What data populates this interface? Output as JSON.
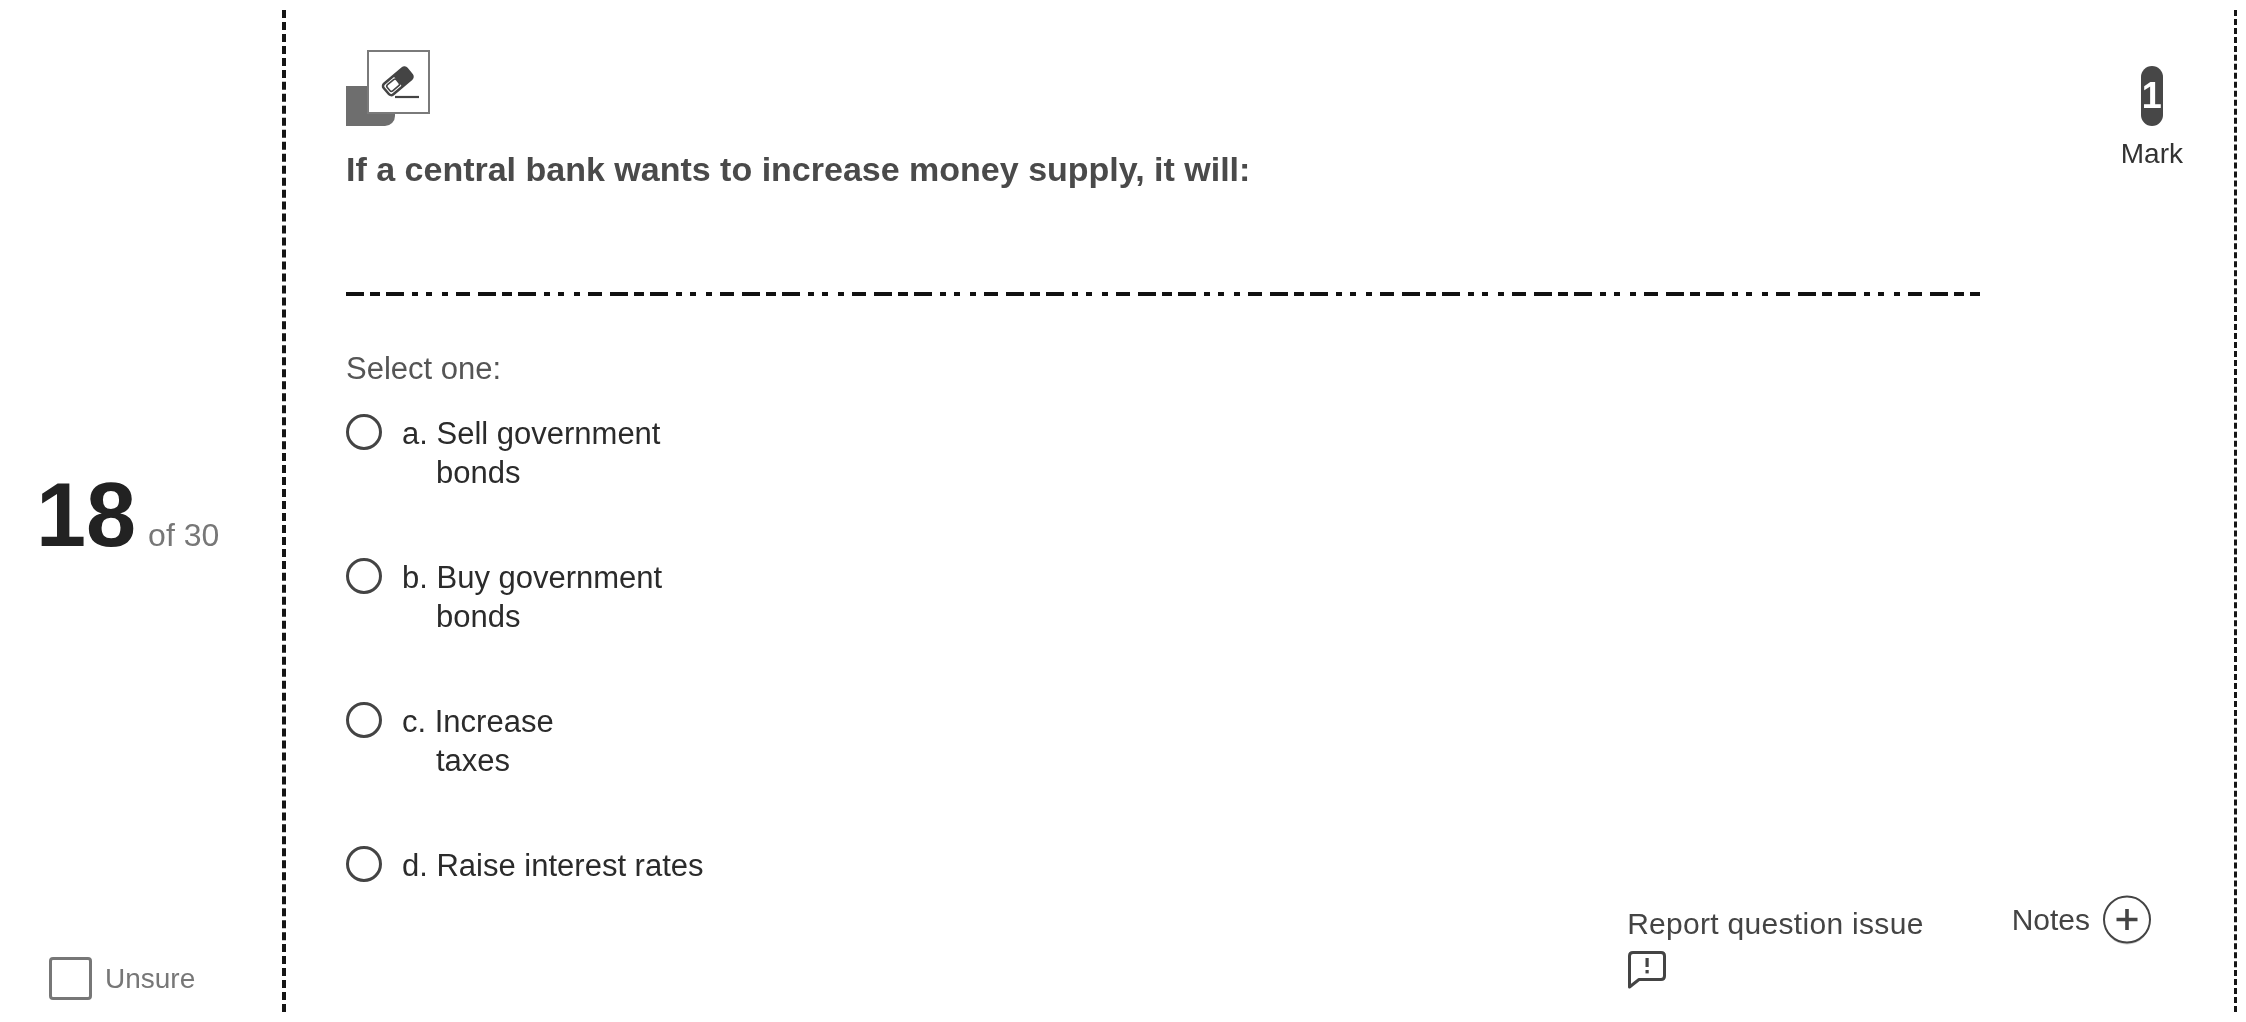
{
  "sidebar": {
    "number": "18",
    "total": "of 30",
    "unsure": {
      "label": "Unsure",
      "checked": false
    }
  },
  "question": {
    "text": "If a central bank wants to increase money supply, it will:",
    "marks": {
      "value": "1",
      "label": "Mark"
    }
  },
  "answer": {
    "prompt": "Select one:",
    "options": [
      {
        "label": "a. Sell government\nbonds",
        "selected": false
      },
      {
        "label": "b. Buy government\nbonds",
        "selected": false
      },
      {
        "label": "c. Increase\ntaxes",
        "selected": false
      },
      {
        "label": "d. Raise interest rates",
        "selected": false
      }
    ]
  },
  "footer": {
    "report": "Report question issue",
    "notes": "Notes"
  }
}
